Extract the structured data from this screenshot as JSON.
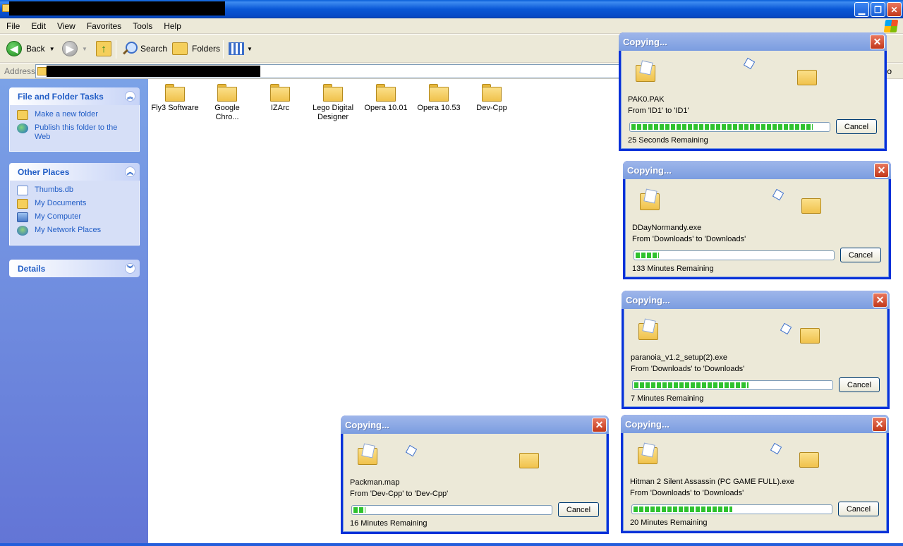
{
  "window": {
    "title_redacted": true
  },
  "menu": {
    "items": [
      "File",
      "Edit",
      "View",
      "Favorites",
      "Tools",
      "Help"
    ]
  },
  "toolbar": {
    "back_label": "Back",
    "search_label": "Search",
    "folders_label": "Folders"
  },
  "address": {
    "label": "Address",
    "go_label": "o"
  },
  "taskpane": {
    "file_tasks": {
      "title": "File and Folder Tasks",
      "items": [
        "Make a new folder",
        "Publish this folder to the Web"
      ]
    },
    "other_places": {
      "title": "Other Places",
      "items": [
        "Thumbs.db",
        "My Documents",
        "My Computer",
        "My Network Places"
      ]
    },
    "details": {
      "title": "Details"
    }
  },
  "folders": [
    "Fly3 Software",
    "Google Chro...",
    "IZArc",
    "Lego Digital Designer",
    "Opera 10.01",
    "Opera 10.53",
    "Dev-Cpp"
  ],
  "dialogs": [
    {
      "title": "Copying...",
      "file": "PAK0.PAK",
      "from": "From 'ID1' to 'ID1'",
      "progress": 0.92,
      "remaining": "25 Seconds Remaining",
      "cancel": "Cancel"
    },
    {
      "title": "Copying...",
      "file": "DDayNormandy.exe",
      "from": "From 'Downloads' to 'Downloads'",
      "progress": 0.12,
      "remaining": "133 Minutes Remaining",
      "cancel": "Cancel"
    },
    {
      "title": "Copying...",
      "file": "paranoia_v1.2_setup(2).exe",
      "from": "From 'Downloads' to 'Downloads'",
      "progress": 0.58,
      "remaining": "7 Minutes Remaining",
      "cancel": "Cancel"
    },
    {
      "title": "Copying...",
      "file": "Packman.map",
      "from": "From 'Dev-Cpp' to 'Dev-Cpp'",
      "progress": 0.06,
      "remaining": "16 Minutes Remaining",
      "cancel": "Cancel"
    },
    {
      "title": "Copying...",
      "file": "Hitman 2 Silent Assassin (PC GAME FULL).exe",
      "from": "From 'Downloads' to 'Downloads'",
      "progress": 0.5,
      "remaining": "20 Minutes Remaining",
      "cancel": "Cancel"
    }
  ]
}
